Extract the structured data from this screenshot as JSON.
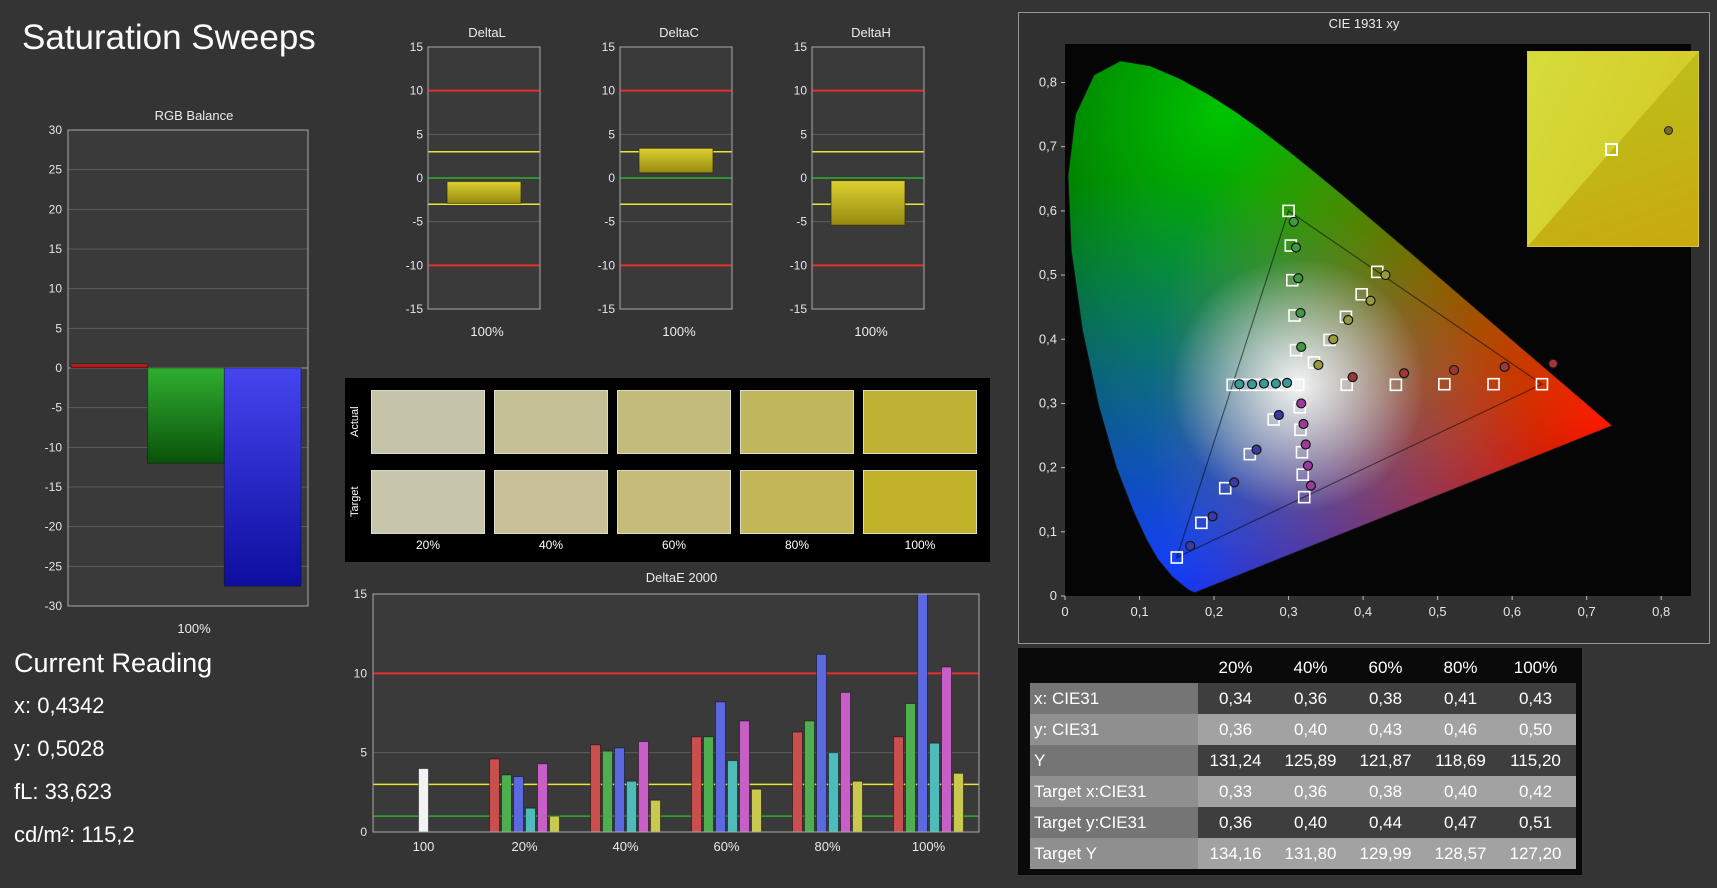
{
  "page": {
    "title": "Saturation Sweeps"
  },
  "current_reading": {
    "title": "Current Reading",
    "lines": [
      "x: 0,4342",
      "y: 0,5028",
      "fL: 33,623",
      "cd/m²: 115,2"
    ]
  },
  "swatches": {
    "row_labels": [
      "Actual",
      "Target"
    ],
    "column_labels": [
      "20%",
      "40%",
      "60%",
      "80%",
      "100%"
    ],
    "actual_colors": [
      "#c6c3ab",
      "#c5bf96",
      "#c3bb7c",
      "#c0b65c",
      "#beb134"
    ],
    "target_colors": [
      "#c8c5ad",
      "#c7c098",
      "#c5bc7a",
      "#c2b656",
      "#c1b128"
    ]
  },
  "chart_data": [
    {
      "id": "rgb_balance",
      "type": "bar",
      "title": "RGB Balance",
      "xlabel": "100%",
      "ylim": [
        -30,
        30
      ],
      "ytick_step": 5,
      "series": [
        {
          "name": "red",
          "color": "#d42a2a",
          "color2": "#8a1010",
          "value": 0.5
        },
        {
          "name": "green",
          "color": "#2fae2f",
          "color2": "#0a520a",
          "value": -12
        },
        {
          "name": "blue",
          "color": "#4545ef",
          "color2": "#0d0d9e",
          "value": -27.5
        }
      ]
    },
    {
      "id": "delta_l",
      "type": "range-bar",
      "title": "DeltaL",
      "xlabel": "100%",
      "ylim": [
        -15,
        15
      ],
      "ytick_step": 5,
      "range": [
        -2.9,
        -0.4
      ],
      "bar_color": "#ddd02f",
      "bar_color2": "#958a10",
      "ref_lines": [
        {
          "y": 10,
          "color": "#e03030"
        },
        {
          "y": -10,
          "color": "#e03030"
        },
        {
          "y": 3,
          "color": "#e8e832"
        },
        {
          "y": -3,
          "color": "#e8e832"
        },
        {
          "y": 0,
          "color": "#2fae2f"
        }
      ]
    },
    {
      "id": "delta_c",
      "type": "range-bar",
      "title": "DeltaC",
      "xlabel": "100%",
      "ylim": [
        -15,
        15
      ],
      "ytick_step": 5,
      "range": [
        0.6,
        3.4
      ],
      "bar_color": "#ddd02f",
      "bar_color2": "#958a10",
      "ref_lines": [
        {
          "y": 10,
          "color": "#e03030"
        },
        {
          "y": -10,
          "color": "#e03030"
        },
        {
          "y": 3,
          "color": "#e8e832"
        },
        {
          "y": -3,
          "color": "#e8e832"
        },
        {
          "y": 0,
          "color": "#2fae2f"
        }
      ]
    },
    {
      "id": "delta_h",
      "type": "range-bar",
      "title": "DeltaH",
      "xlabel": "100%",
      "ylim": [
        -15,
        15
      ],
      "ytick_step": 5,
      "range": [
        -5.4,
        -0.3
      ],
      "bar_color": "#ddd02f",
      "bar_color2": "#958a10",
      "ref_lines": [
        {
          "y": 10,
          "color": "#e03030"
        },
        {
          "y": -10,
          "color": "#e03030"
        },
        {
          "y": 3,
          "color": "#e8e832"
        },
        {
          "y": -3,
          "color": "#e8e832"
        },
        {
          "y": 0,
          "color": "#2fae2f"
        }
      ]
    },
    {
      "id": "deltae2000",
      "type": "bar",
      "title": "DeltaE 2000",
      "ylim": [
        0,
        15
      ],
      "yticks": [
        0,
        5,
        10,
        15
      ],
      "ref_lines": [
        {
          "y": 1,
          "color": "#2fae2f"
        },
        {
          "y": 3,
          "color": "#e8e832"
        },
        {
          "y": 10,
          "color": "#e03030"
        }
      ],
      "groups": [
        {
          "label": "100",
          "bars": [
            {
              "color": "#f2f2f2",
              "value": 4.0
            }
          ]
        },
        {
          "label": "20%",
          "bars": [
            {
              "color": "#c94f4f",
              "value": 4.6
            },
            {
              "color": "#4fae4f",
              "value": 3.6
            },
            {
              "color": "#5b68e0",
              "value": 3.5
            },
            {
              "color": "#4fbcbc",
              "value": 1.5
            },
            {
              "color": "#c75fc7",
              "value": 4.3
            },
            {
              "color": "#c9c94f",
              "value": 1.0
            }
          ]
        },
        {
          "label": "40%",
          "bars": [
            {
              "color": "#c94f4f",
              "value": 5.5
            },
            {
              "color": "#4fae4f",
              "value": 5.1
            },
            {
              "color": "#5b68e0",
              "value": 5.3
            },
            {
              "color": "#4fbcbc",
              "value": 3.2
            },
            {
              "color": "#c75fc7",
              "value": 5.7
            },
            {
              "color": "#c9c94f",
              "value": 2.0
            }
          ]
        },
        {
          "label": "60%",
          "bars": [
            {
              "color": "#c94f4f",
              "value": 6.0
            },
            {
              "color": "#4fae4f",
              "value": 6.0
            },
            {
              "color": "#5b68e0",
              "value": 8.2
            },
            {
              "color": "#4fbcbc",
              "value": 4.5
            },
            {
              "color": "#c75fc7",
              "value": 7.0
            },
            {
              "color": "#c9c94f",
              "value": 2.7
            }
          ]
        },
        {
          "label": "80%",
          "bars": [
            {
              "color": "#c94f4f",
              "value": 6.3
            },
            {
              "color": "#4fae4f",
              "value": 7.0
            },
            {
              "color": "#5b68e0",
              "value": 11.2
            },
            {
              "color": "#4fbcbc",
              "value": 5.0
            },
            {
              "color": "#c75fc7",
              "value": 8.8
            },
            {
              "color": "#c9c94f",
              "value": 3.2
            }
          ]
        },
        {
          "label": "100%",
          "bars": [
            {
              "color": "#c94f4f",
              "value": 6.0
            },
            {
              "color": "#4fae4f",
              "value": 8.1
            },
            {
              "color": "#5b68e0",
              "value": 15.0
            },
            {
              "color": "#4fbcbc",
              "value": 5.6
            },
            {
              "color": "#c75fc7",
              "value": 10.4
            },
            {
              "color": "#c9c94f",
              "value": 3.7
            }
          ]
        }
      ]
    },
    {
      "id": "cie1931",
      "type": "scatter",
      "title": "CIE 1931 xy",
      "xlim": [
        0,
        0.84
      ],
      "ylim": [
        0,
        0.86
      ],
      "tick_values": [
        0,
        0.1,
        0.2,
        0.3,
        0.4,
        0.5,
        0.6,
        0.7,
        0.8
      ],
      "tick_labels": [
        "0",
        "0,1",
        "0,2",
        "0,3",
        "0,4",
        "0,5",
        "0,6",
        "0,7",
        "0,8"
      ],
      "white_point": [
        0.313,
        0.329
      ],
      "gamut_triangle": [
        [
          0.64,
          0.33
        ],
        [
          0.3,
          0.6
        ],
        [
          0.15,
          0.06
        ]
      ],
      "targets": [
        [
          0.313,
          0.329
        ],
        [
          0.378,
          0.329
        ],
        [
          0.444,
          0.329
        ],
        [
          0.509,
          0.33
        ],
        [
          0.575,
          0.33
        ],
        [
          0.64,
          0.33
        ],
        [
          0.31,
          0.383
        ],
        [
          0.308,
          0.437
        ],
        [
          0.305,
          0.492
        ],
        [
          0.303,
          0.546
        ],
        [
          0.3,
          0.6
        ],
        [
          0.28,
          0.275
        ],
        [
          0.248,
          0.221
        ],
        [
          0.215,
          0.168
        ],
        [
          0.183,
          0.114
        ],
        [
          0.15,
          0.06
        ],
        [
          0.295,
          0.329
        ],
        [
          0.278,
          0.329
        ],
        [
          0.26,
          0.329
        ],
        [
          0.243,
          0.329
        ],
        [
          0.225,
          0.329
        ],
        [
          0.315,
          0.294
        ],
        [
          0.316,
          0.259
        ],
        [
          0.318,
          0.224
        ],
        [
          0.319,
          0.189
        ],
        [
          0.321,
          0.154
        ],
        [
          0.334,
          0.364
        ],
        [
          0.355,
          0.399
        ],
        [
          0.377,
          0.435
        ],
        [
          0.398,
          0.47
        ],
        [
          0.419,
          0.505
        ]
      ],
      "measurements": [
        {
          "x": 0.386,
          "y": 0.341,
          "color": "#a03636"
        },
        {
          "x": 0.455,
          "y": 0.347,
          "color": "#a03636"
        },
        {
          "x": 0.522,
          "y": 0.352,
          "color": "#a03636"
        },
        {
          "x": 0.59,
          "y": 0.357,
          "color": "#a03636"
        },
        {
          "x": 0.655,
          "y": 0.362,
          "color": "#a03636"
        },
        {
          "x": 0.317,
          "y": 0.388,
          "color": "#3f9a3f"
        },
        {
          "x": 0.316,
          "y": 0.441,
          "color": "#3f9a3f"
        },
        {
          "x": 0.313,
          "y": 0.495,
          "color": "#3f9a3f"
        },
        {
          "x": 0.31,
          "y": 0.543,
          "color": "#3f9a3f"
        },
        {
          "x": 0.307,
          "y": 0.583,
          "color": "#3f9a3f"
        },
        {
          "x": 0.287,
          "y": 0.282,
          "color": "#3a3aa8"
        },
        {
          "x": 0.257,
          "y": 0.228,
          "color": "#3a3aa8"
        },
        {
          "x": 0.227,
          "y": 0.177,
          "color": "#3a3aa8"
        },
        {
          "x": 0.198,
          "y": 0.124,
          "color": "#3a3aa8"
        },
        {
          "x": 0.168,
          "y": 0.078,
          "color": "#3a3aa8"
        },
        {
          "x": 0.298,
          "y": 0.332,
          "color": "#3a9a9a"
        },
        {
          "x": 0.283,
          "y": 0.331,
          "color": "#3a9a9a"
        },
        {
          "x": 0.267,
          "y": 0.331,
          "color": "#3a9a9a"
        },
        {
          "x": 0.251,
          "y": 0.33,
          "color": "#3a9a9a"
        },
        {
          "x": 0.234,
          "y": 0.33,
          "color": "#3a9a9a"
        },
        {
          "x": 0.317,
          "y": 0.3,
          "color": "#9a3a9a"
        },
        {
          "x": 0.32,
          "y": 0.268,
          "color": "#9a3a9a"
        },
        {
          "x": 0.323,
          "y": 0.236,
          "color": "#9a3a9a"
        },
        {
          "x": 0.326,
          "y": 0.203,
          "color": "#9a3a9a"
        },
        {
          "x": 0.33,
          "y": 0.172,
          "color": "#9a3a9a"
        },
        {
          "x": 0.34,
          "y": 0.36,
          "color": "#9a9a3a"
        },
        {
          "x": 0.36,
          "y": 0.4,
          "color": "#9a9a3a"
        },
        {
          "x": 0.38,
          "y": 0.43,
          "color": "#9a9a3a"
        },
        {
          "x": 0.41,
          "y": 0.46,
          "color": "#9a9a3a"
        },
        {
          "x": 0.43,
          "y": 0.5,
          "color": "#9a9a3a"
        }
      ],
      "inset": {
        "target": [
          0.419,
          0.505
        ],
        "measurement": {
          "x": 0.433,
          "y": 0.498,
          "color": "#6f6f23"
        }
      }
    },
    {
      "id": "results",
      "type": "table",
      "header": [
        "",
        "20%",
        "40%",
        "60%",
        "80%",
        "100%"
      ],
      "rows": [
        {
          "label": "x: CIE31",
          "values": [
            "0,34",
            "0,36",
            "0,38",
            "0,41",
            "0,43"
          ]
        },
        {
          "label": "y: CIE31",
          "values": [
            "0,36",
            "0,40",
            "0,43",
            "0,46",
            "0,50"
          ]
        },
        {
          "label": "Y",
          "values": [
            "131,24",
            "125,89",
            "121,87",
            "118,69",
            "115,20"
          ]
        },
        {
          "label": "Target x:CIE31",
          "values": [
            "0,33",
            "0,36",
            "0,38",
            "0,40",
            "0,42"
          ]
        },
        {
          "label": "Target y:CIE31",
          "values": [
            "0,36",
            "0,40",
            "0,44",
            "0,47",
            "0,51"
          ]
        },
        {
          "label": "Target Y",
          "values": [
            "134,16",
            "131,80",
            "129,99",
            "128,57",
            "127,20"
          ]
        }
      ]
    }
  ]
}
